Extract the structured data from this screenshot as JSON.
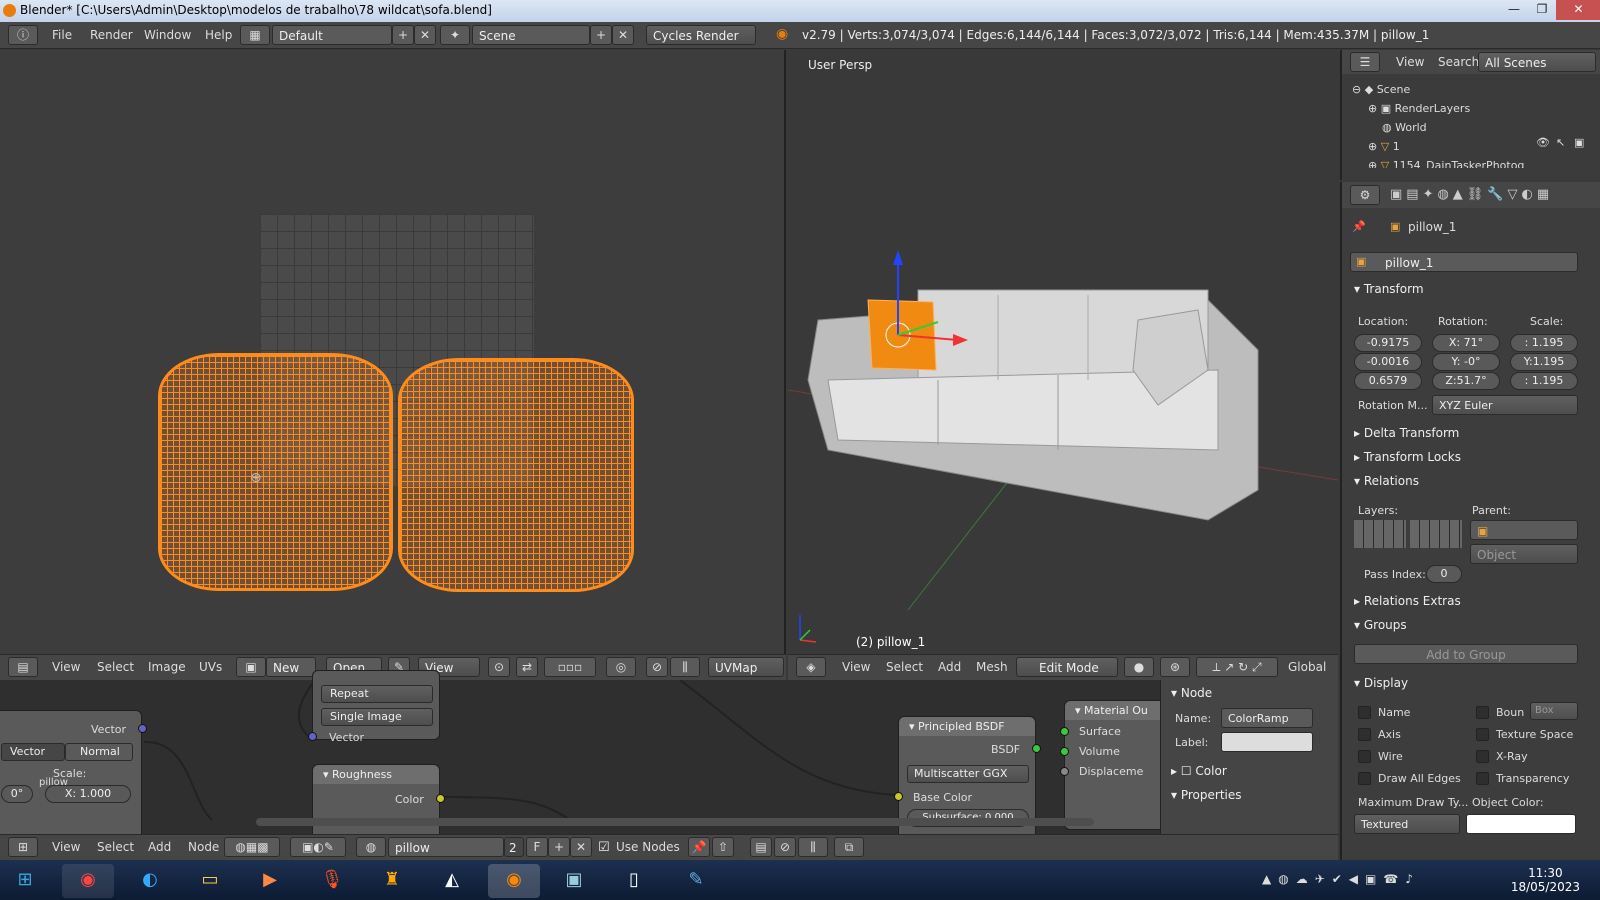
{
  "window": {
    "title": "Blender* [C:\\Users\\Admin\\Desktop\\modelos de trabalho\\78 wildcat\\sofa.blend]",
    "controls": [
      "—",
      "❐",
      "✕"
    ]
  },
  "info_header": {
    "menus": [
      "File",
      "Render",
      "Window",
      "Help"
    ],
    "layout": "Default",
    "scene": "Scene",
    "engine": "Cycles Render",
    "stats": "v2.79 | Verts:3,074/3,074 | Edges:6,144/6,144 | Faces:3,072/3,072 | Tris:6,144 | Mem:435.37M | pillow_1"
  },
  "viewport": {
    "label": "User Persp",
    "object_label": "(2) pillow_1",
    "header": {
      "menus": [
        "View",
        "Select",
        "Add",
        "Mesh"
      ],
      "mode": "Edit Mode",
      "orientation": "Global"
    }
  },
  "uv_editor": {
    "header": {
      "menus": [
        "View",
        "Select",
        "Image",
        "UVs"
      ],
      "new": "New",
      "open": "Open",
      "view": "View",
      "uvmap": "UVMap"
    }
  },
  "outliner": {
    "menus": [
      "View",
      "Search"
    ],
    "filter": "All Scenes",
    "items": [
      {
        "label": "Scene",
        "icon": "scene-icon"
      },
      {
        "label": "RenderLayers",
        "icon": "renderlayers-icon"
      },
      {
        "label": "World",
        "icon": "world-icon"
      },
      {
        "label": "1",
        "icon": "mesh-icon"
      },
      {
        "label": "1154_DainTaskerPhotog",
        "icon": "mesh-icon"
      }
    ]
  },
  "properties": {
    "object_name": "pillow_1",
    "datablock_name": "pillow_1",
    "transform": {
      "title": "Transform",
      "location_label": "Location:",
      "rotation_label": "Rotation:",
      "scale_label": "Scale:",
      "location": [
        "-0.9175",
        "-0.0016",
        "0.6579"
      ],
      "rotation": [
        "X:  71°",
        "Y:   -0°",
        "Z:51.7°"
      ],
      "scale": [
        ":  1.195",
        "Y:1.195",
        ":  1.195"
      ],
      "rotation_mode_label": "Rotation M...",
      "rotation_mode": "XYZ Euler"
    },
    "collapsed_panels": [
      "Delta Transform",
      "Transform Locks"
    ],
    "relations": {
      "title": "Relations",
      "layers_label": "Layers:",
      "parent_label": "Parent:",
      "parent_type": "Object",
      "pass_index_label": "Pass Index:",
      "pass_index": "0"
    },
    "relations_extras": "Relations Extras",
    "groups": {
      "title": "Groups",
      "add": "Add to Group"
    },
    "display": {
      "title": "Display",
      "left": [
        "Name",
        "Axis",
        "Wire",
        "Draw All Edges"
      ],
      "right": [
        "Boun",
        "Texture Space",
        "X-Ray",
        "Transparency"
      ],
      "bounds_type": "Box",
      "max_draw_label": "Maximum Draw Ty...",
      "object_color_label": "Object Color:",
      "max_draw": "Textured"
    }
  },
  "node_editor": {
    "header": {
      "menus": [
        "View",
        "Select",
        "Add",
        "Node"
      ],
      "material": "pillow",
      "users": "2",
      "fake": "F",
      "use_nodes": "Use Nodes"
    },
    "left_node": {
      "output": "Vector",
      "modes": [
        "Vector",
        "Normal"
      ],
      "scale_label": "Scale:",
      "scale_x": "X:    1.000",
      "partial_value": "0°",
      "overlay_text": "pillow"
    },
    "texture_node": {
      "extension": "Repeat",
      "source": "Single Image",
      "input": "Vector"
    },
    "roughness_node": {
      "title": "Roughness",
      "output": "Color"
    },
    "principled": {
      "title": "Principled BSDF",
      "output": "BSDF",
      "distribution": "Multiscatter GGX",
      "base_color": "Base Color",
      "subsurface": "Subsurface: 0.000"
    },
    "material_output": {
      "title": "Material Ou",
      "inputs": [
        "Surface",
        "Volume",
        "Displaceme"
      ]
    }
  },
  "node_sidebar": {
    "node_title": "Node",
    "name_label": "Name:",
    "name": "ColorRamp",
    "label_label": "Label:",
    "label": "",
    "color": "Color",
    "properties": "Properties"
  },
  "taskbar": {
    "apps": [
      "start",
      "chrome",
      "edge",
      "explorer",
      "media",
      "mic",
      "game",
      "unity",
      "blender",
      "app",
      "file",
      "paint"
    ],
    "time": "11:30",
    "date": "18/05/2023"
  },
  "colors": {
    "accent": "#ff8c1a",
    "x_axis": "#e33",
    "y_axis": "#3c3",
    "z_axis": "#24f"
  }
}
